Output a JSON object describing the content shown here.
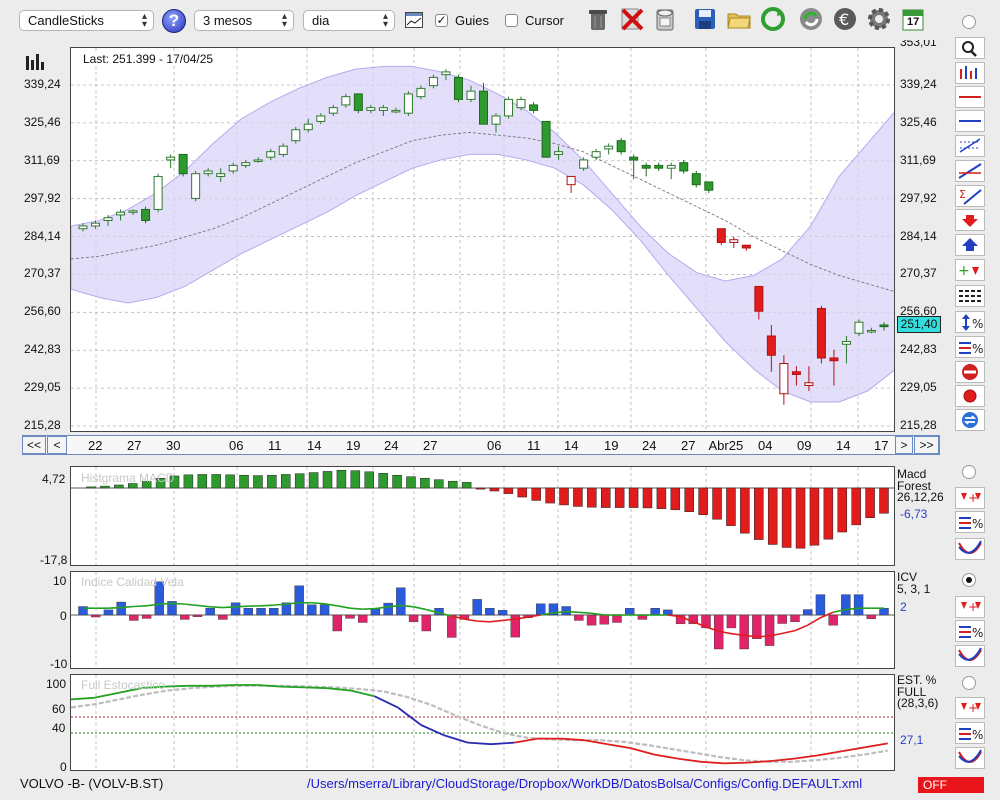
{
  "toolbar": {
    "chart_type": "CandleSticks",
    "period": "3 mesos",
    "interval": "dia",
    "guies_label": "Guies",
    "guies_checked": true,
    "cursor_label": "Cursor",
    "cursor_checked": false,
    "help_glyph": "?",
    "calendar_day": "17",
    "icons": [
      "help-icon",
      "chart-window-icon",
      "trash-icon",
      "delete-icon",
      "database-icon",
      "save-icon",
      "open-folder-icon",
      "refresh-icon",
      "sync-icon",
      "euro-icon",
      "gear-icon",
      "calendar-icon"
    ]
  },
  "main_chart": {
    "last_label": "Last: 251.399 - 17/04/25",
    "y_ticks": [
      "339,24",
      "325,46",
      "311,69",
      "297,92",
      "284,14",
      "270,37",
      "256,60",
      "242,83",
      "229,05",
      "215,28"
    ],
    "y_top_partial": "353,01",
    "last_price_badge": "251,40",
    "x_ticks": [
      "22",
      "27",
      "30",
      "06",
      "11",
      "14",
      "19",
      "24",
      "27",
      "06",
      "11",
      "14",
      "19",
      "24",
      "27",
      "Abr25",
      "04",
      "09",
      "14",
      "17"
    ],
    "nav_first": "<<",
    "nav_prev": "<",
    "nav_next": ">",
    "nav_last": ">>"
  },
  "macd": {
    "title": "Histgrama MACD",
    "name": "Macd",
    "subname": "Forest",
    "params": "26,12,26",
    "value": "-6,73",
    "y_top": "4,72",
    "y_bottom": "-17,8",
    "colors": {
      "up": "#2e9a2e",
      "down": "#e01c1c"
    }
  },
  "icv": {
    "title": "Indice Calidad Vela",
    "name": "ICV",
    "params": "5, 3, 1",
    "value": "2",
    "y_top": "10",
    "y_mid": "0",
    "y_bottom": "-10",
    "colors": {
      "up": "#2a5bdc",
      "down": "#e0246a"
    }
  },
  "stoch": {
    "title": "Full Estocastico",
    "name": "EST. %",
    "subname": "FULL",
    "params": "(28,3,6)",
    "value": "27,1",
    "y_ticks": [
      "100",
      "60",
      "40",
      "0"
    ]
  },
  "status": {
    "symbol": "VOLVO -B- (VOLV-B.ST)",
    "path": "/Users/mserra/Library/CloudStorage/Dropbox/WorkDB/DatosBolsa/Configs/Config.DEFAULT.xml",
    "off_label": "OFF"
  },
  "right_tools": [
    "zoom-icon",
    "chart-style-icon",
    "horizontal-line-red-icon",
    "horizontal-line-blue-icon",
    "fibonacci-icon",
    "trendline-icon",
    "sigma-icon",
    "down-arrow-icon",
    "up-arrow-icon",
    "add-signal-icon",
    "grid-lines-icon",
    "scale-percent-icon",
    "equal-percent-icon",
    "no-entry-icon",
    "record-icon",
    "swap-icon"
  ],
  "chart_data": [
    {
      "type": "candlestick",
      "title": "",
      "ylim": [
        215.28,
        353.01
      ],
      "last": 251.399,
      "candles": [
        {
          "o": 287,
          "h": 289,
          "l": 286,
          "c": 288
        },
        {
          "o": 288,
          "h": 290,
          "l": 287,
          "c": 289
        },
        {
          "o": 290,
          "h": 292,
          "l": 288,
          "c": 291
        },
        {
          "o": 292,
          "h": 294,
          "l": 290,
          "c": 293
        },
        {
          "o": 293,
          "h": 294,
          "l": 292,
          "c": 293.5
        },
        {
          "o": 294,
          "h": 295,
          "l": 289,
          "c": 290
        },
        {
          "o": 294,
          "h": 307,
          "l": 293,
          "c": 306
        },
        {
          "o": 312,
          "h": 314,
          "l": 309,
          "c": 313
        },
        {
          "o": 314,
          "h": 314,
          "l": 306,
          "c": 307
        },
        {
          "o": 298,
          "h": 308,
          "l": 297,
          "c": 307
        },
        {
          "o": 307,
          "h": 309,
          "l": 306,
          "c": 308
        },
        {
          "o": 306,
          "h": 309,
          "l": 304,
          "c": 307
        },
        {
          "o": 308,
          "h": 311,
          "l": 307,
          "c": 310
        },
        {
          "o": 310,
          "h": 312,
          "l": 309,
          "c": 311
        },
        {
          "o": 312,
          "h": 313,
          "l": 311,
          "c": 312
        },
        {
          "o": 313,
          "h": 316,
          "l": 312,
          "c": 315
        },
        {
          "o": 314,
          "h": 318,
          "l": 313,
          "c": 317
        },
        {
          "o": 319,
          "h": 324,
          "l": 318,
          "c": 323
        },
        {
          "o": 323,
          "h": 327,
          "l": 322,
          "c": 325
        },
        {
          "o": 326,
          "h": 329,
          "l": 325,
          "c": 328
        },
        {
          "o": 329,
          "h": 332,
          "l": 328,
          "c": 331
        },
        {
          "o": 332,
          "h": 336,
          "l": 331,
          "c": 335
        },
        {
          "o": 336,
          "h": 336,
          "l": 329,
          "c": 330
        },
        {
          "o": 330,
          "h": 332,
          "l": 329,
          "c": 331
        },
        {
          "o": 330,
          "h": 332,
          "l": 328,
          "c": 331
        },
        {
          "o": 330,
          "h": 331,
          "l": 329,
          "c": 330
        },
        {
          "o": 329,
          "h": 337,
          "l": 328,
          "c": 336
        },
        {
          "o": 335,
          "h": 339,
          "l": 334,
          "c": 338
        },
        {
          "o": 339,
          "h": 343,
          "l": 338,
          "c": 342
        },
        {
          "o": 343,
          "h": 345,
          "l": 341,
          "c": 344
        },
        {
          "o": 342,
          "h": 343,
          "l": 333,
          "c": 334
        },
        {
          "o": 334,
          "h": 339,
          "l": 333,
          "c": 337
        },
        {
          "o": 337,
          "h": 340,
          "l": 326,
          "c": 325
        },
        {
          "o": 325,
          "h": 329,
          "l": 322,
          "c": 328
        },
        {
          "o": 328,
          "h": 335,
          "l": 327,
          "c": 334
        },
        {
          "o": 331,
          "h": 335,
          "l": 330,
          "c": 334
        },
        {
          "o": 332,
          "h": 333,
          "l": 329,
          "c": 330
        },
        {
          "o": 326,
          "h": 326,
          "l": 313,
          "c": 313
        },
        {
          "o": 314,
          "h": 317,
          "l": 312,
          "c": 315
        },
        {
          "o": 306,
          "h": 306,
          "l": 300,
          "c": 303
        },
        {
          "o": 309,
          "h": 313,
          "l": 308,
          "c": 312
        },
        {
          "o": 313,
          "h": 316,
          "l": 312,
          "c": 315
        },
        {
          "o": 316,
          "h": 318,
          "l": 314,
          "c": 317
        },
        {
          "o": 319,
          "h": 320,
          "l": 314,
          "c": 315
        },
        {
          "o": 313,
          "h": 314,
          "l": 305,
          "c": 312
        },
        {
          "o": 310,
          "h": 311,
          "l": 306,
          "c": 309
        },
        {
          "o": 310,
          "h": 311,
          "l": 308,
          "c": 309
        },
        {
          "o": 309,
          "h": 311,
          "l": 305,
          "c": 310
        },
        {
          "o": 311,
          "h": 312,
          "l": 307,
          "c": 308
        },
        {
          "o": 307,
          "h": 308,
          "l": 302,
          "c": 303
        },
        {
          "o": 304,
          "h": 304,
          "l": 300,
          "c": 301
        },
        {
          "o": 287,
          "h": 287,
          "l": 281,
          "c": 282
        },
        {
          "o": 282,
          "h": 284,
          "l": 280,
          "c": 283
        },
        {
          "o": 281,
          "h": 281,
          "l": 279,
          "c": 280
        },
        {
          "o": 266,
          "h": 266,
          "l": 254,
          "c": 257
        },
        {
          "o": 248,
          "h": 252,
          "l": 235,
          "c": 241
        },
        {
          "o": 227,
          "h": 241,
          "l": 223,
          "c": 238
        },
        {
          "o": 235,
          "h": 237,
          "l": 230,
          "c": 234
        },
        {
          "o": 230,
          "h": 237,
          "l": 228,
          "c": 231
        },
        {
          "o": 258,
          "h": 259,
          "l": 238,
          "c": 240
        },
        {
          "o": 240,
          "h": 243,
          "l": 230,
          "c": 239
        },
        {
          "o": 245,
          "h": 248,
          "l": 238,
          "c": 246
        },
        {
          "o": 249,
          "h": 254,
          "l": 248,
          "c": 253
        },
        {
          "o": 250,
          "h": 251,
          "l": 249,
          "c": 250
        },
        {
          "o": 252,
          "h": 253,
          "l": 250,
          "c": 251.4
        }
      ],
      "bollinger_upper": [
        288,
        290,
        294,
        300,
        308,
        318,
        327,
        333,
        338,
        342,
        345,
        346,
        346,
        344,
        341,
        336,
        330,
        322,
        312,
        300,
        288,
        278,
        271,
        268,
        270,
        276,
        288,
        306,
        318,
        330
      ],
      "bollinger_lower": [
        265,
        262,
        260,
        262,
        266,
        272,
        278,
        283,
        288,
        293,
        299,
        304,
        309,
        312,
        314,
        314,
        312,
        309,
        303,
        294,
        283,
        270,
        258,
        246,
        236,
        228,
        224,
        224,
        228,
        236
      ],
      "ma_line": [
        276,
        277,
        279,
        281,
        284,
        287,
        291,
        296,
        301,
        306,
        311,
        315,
        319,
        321,
        322,
        321,
        320,
        318,
        315,
        310,
        305,
        300,
        295,
        290,
        284,
        279,
        274,
        270,
        267,
        264
      ]
    },
    {
      "type": "bar",
      "title": "Histgrama MACD",
      "ylim": [
        -17.8,
        4.72
      ],
      "values": [
        0.3,
        0.5,
        0.8,
        1.2,
        1.8,
        2.6,
        3.2,
        3.5,
        3.6,
        3.6,
        3.5,
        3.4,
        3.3,
        3.4,
        3.6,
        3.8,
        4.1,
        4.4,
        4.7,
        4.6,
        4.3,
        3.9,
        3.4,
        3.0,
        2.6,
        2.2,
        1.8,
        1.5,
        -0.3,
        -0.8,
        -1.5,
        -2.4,
        -3.3,
        -4.0,
        -4.5,
        -4.9,
        -5.1,
        -5.2,
        -5.2,
        -5.2,
        -5.3,
        -5.5,
        -5.8,
        -6.3,
        -7.1,
        -8.3,
        -10.0,
        -12.0,
        -13.7,
        -15.0,
        -15.8,
        -16.0,
        -15.2,
        -13.6,
        -11.7,
        -9.8,
        -7.9,
        -6.7
      ]
    },
    {
      "type": "bar",
      "title": "Indice Calidad Vela",
      "ylim": [
        -10,
        10
      ],
      "values": [
        2.5,
        -0.6,
        1.5,
        3.8,
        -1.6,
        -1.0,
        9.8,
        4.0,
        -1.3,
        -0.5,
        2.0,
        -1.3,
        3.6,
        2.0,
        2.0,
        2.0,
        3.6,
        8.6,
        3.0,
        3.0,
        -4.7,
        -1.0,
        -2.2,
        1.8,
        3.5,
        8.0,
        -2.0,
        -4.7,
        2.0,
        -6.6,
        -1.3,
        4.6,
        2.0,
        1.4,
        -6.5,
        -0.8,
        3.3,
        3.3,
        2.5,
        -1.6,
        -3.0,
        -2.7,
        -2.2,
        2.0,
        -1.3,
        2.0,
        1.5,
        -2.6,
        -2.6,
        -3.8,
        -10.0,
        -3.8,
        -10.0,
        -7.0,
        -9.0,
        -2.5,
        -2.0,
        1.6,
        6.0,
        -3.0,
        6.0,
        6.0,
        -1.1,
        2.0
      ],
      "signal": [
        2,
        2,
        2,
        2.2,
        2.5,
        2.7,
        3.2,
        3.4,
        3.2,
        2.8,
        2.4,
        2.2,
        2.4,
        2.6,
        2.7,
        2.9,
        3.2,
        3.6,
        3.6,
        3.3,
        2.7,
        2.0,
        1.7,
        1.9,
        2.4,
        2.8,
        2.4,
        1.6,
        0.6,
        -0.3,
        -1.2,
        -1.8,
        -2.0,
        -1.6,
        -1.2,
        -0.6,
        0,
        0.6,
        1.0,
        0.8,
        0.5,
        0,
        0,
        0,
        0,
        0,
        0,
        -0.5,
        -2.0,
        -3.5,
        -4.8,
        -5.5,
        -6.0,
        -6.4,
        -6.2,
        -5.4,
        -4.6,
        -3.0,
        -0.8,
        0.8,
        1.6,
        2.0,
        2.0,
        2.0
      ]
    },
    {
      "type": "line",
      "title": "Full Estocastico",
      "ylim": [
        0,
        100
      ],
      "k": [
        82,
        84,
        90,
        96,
        98,
        99,
        99,
        100,
        100,
        98,
        97,
        96,
        93,
        86,
        72,
        50,
        37,
        28,
        26,
        28,
        33,
        33,
        31,
        26,
        21,
        13,
        8,
        4,
        2,
        3,
        5,
        8,
        12,
        17,
        22,
        27
      ],
      "d": [
        72,
        76,
        82,
        88,
        93,
        96,
        98,
        99,
        99,
        99,
        98,
        97,
        95,
        92,
        85,
        75,
        62,
        50,
        40,
        34,
        32,
        31,
        31,
        29,
        25,
        20,
        15,
        10,
        6,
        4,
        4,
        6,
        9,
        13,
        18
      ]
    }
  ]
}
